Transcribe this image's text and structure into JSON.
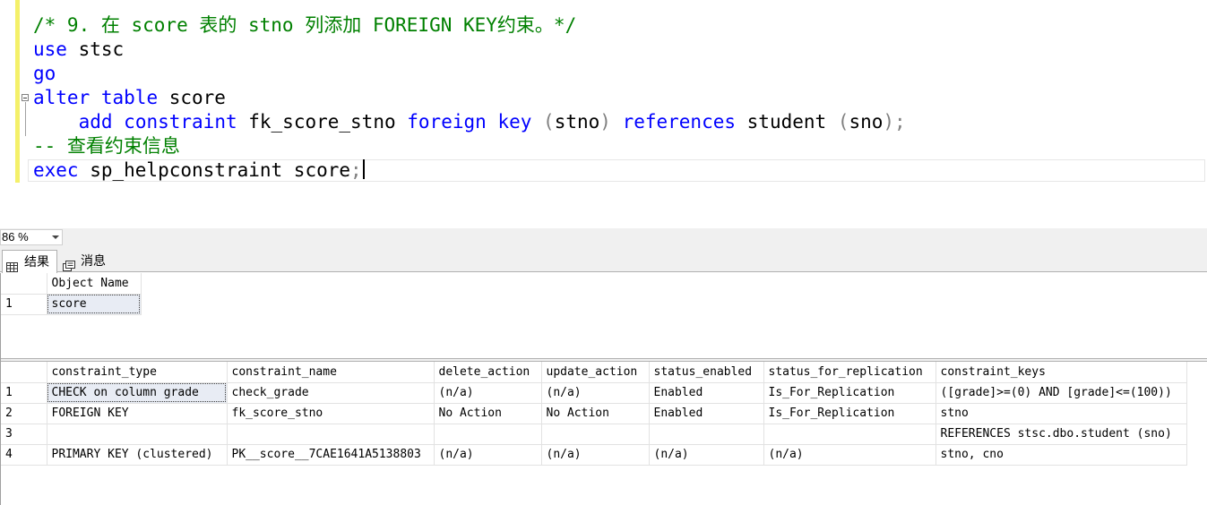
{
  "editor": {
    "lines": [
      {
        "parts": [
          [
            "cm",
            "/* 9. 在 score 表的 stno 列添加 FOREIGN KEY约束。*/"
          ]
        ]
      },
      {
        "parts": [
          [
            "kw",
            "use"
          ],
          [
            "",
            " stsc"
          ]
        ]
      },
      {
        "parts": [
          [
            "kw",
            "go"
          ]
        ]
      },
      {
        "parts": [
          [
            "kw",
            "alter"
          ],
          [
            "",
            " "
          ],
          [
            "kw",
            "table"
          ],
          [
            "",
            " score"
          ]
        ]
      },
      {
        "parts": [
          [
            "",
            "    "
          ],
          [
            "kw",
            "add"
          ],
          [
            "",
            " "
          ],
          [
            "kw",
            "constraint"
          ],
          [
            "",
            " fk_score_stno "
          ],
          [
            "kw",
            "foreign"
          ],
          [
            "",
            " "
          ],
          [
            "kw",
            "key"
          ],
          [
            "",
            " "
          ],
          [
            "gy",
            "("
          ],
          [
            "",
            "stno"
          ],
          [
            "gy",
            ")"
          ],
          [
            "",
            " "
          ],
          [
            "kw",
            "references"
          ],
          [
            "",
            " student "
          ],
          [
            "gy",
            "("
          ],
          [
            "",
            "sno"
          ],
          [
            "gy",
            ");"
          ]
        ]
      },
      {
        "parts": [
          [
            "cm",
            "-- 查看约束信息"
          ]
        ]
      },
      {
        "parts": [
          [
            "kw",
            "exec"
          ],
          [
            "",
            " sp_helpconstraint score"
          ],
          [
            "gy",
            ";"
          ]
        ]
      }
    ]
  },
  "zoom": {
    "value": "86 %"
  },
  "tabs": {
    "results": "结果",
    "messages": "消息"
  },
  "grid1": {
    "columns": [
      "Object Name"
    ],
    "rows": [
      {
        "num": "1",
        "cells": [
          "score"
        ]
      }
    ]
  },
  "grid2": {
    "columns": [
      "constraint_type",
      "constraint_name",
      "delete_action",
      "update_action",
      "status_enabled",
      "status_for_replication",
      "constraint_keys"
    ],
    "rows": [
      {
        "num": "1",
        "cells": [
          "CHECK on column grade",
          "check_grade",
          "(n/a)",
          "(n/a)",
          "Enabled",
          "Is_For_Replication",
          "([grade]>=(0) AND [grade]<=(100))"
        ]
      },
      {
        "num": "2",
        "cells": [
          "FOREIGN KEY",
          "fk_score_stno",
          "No Action",
          "No Action",
          "Enabled",
          "Is_For_Replication",
          "stno"
        ]
      },
      {
        "num": "3",
        "cells": [
          "",
          "",
          "",
          "",
          "",
          "",
          "REFERENCES stsc.dbo.student (sno)"
        ]
      },
      {
        "num": "4",
        "cells": [
          "PRIMARY KEY (clustered)",
          "PK__score__7CAE1641A5138803",
          "(n/a)",
          "(n/a)",
          "(n/a)",
          "(n/a)",
          "stno, cno"
        ]
      }
    ]
  }
}
